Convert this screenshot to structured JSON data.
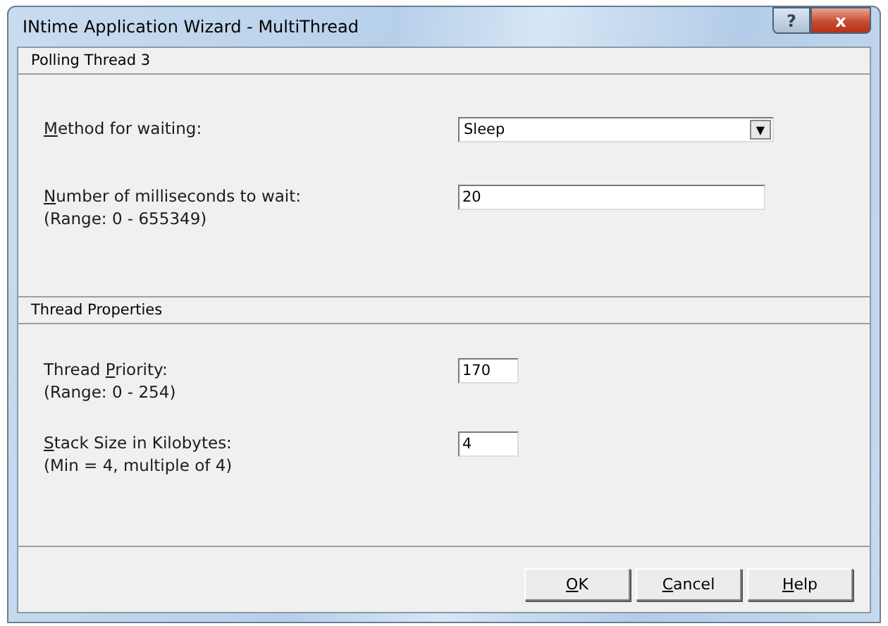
{
  "window": {
    "title": "INtime Application Wizard - MultiThread",
    "caption_buttons": [
      {
        "kind": "help",
        "label": "?"
      },
      {
        "kind": "close",
        "label": "x"
      }
    ]
  },
  "sections": [
    {
      "title": "Polling Thread 3",
      "fields": [
        {
          "kind": "dropdown",
          "label": {
            "key": "M",
            "after": "ethod for waiting:"
          },
          "value": "Sleep",
          "arrow": "▼"
        },
        {
          "kind": "wide_text",
          "label": {
            "key": "N",
            "after": "umber of milliseconds to wait:"
          },
          "hint": "(Range:  0 - 655349)",
          "value": "20"
        }
      ]
    },
    {
      "title": "Thread Properties",
      "fields": [
        {
          "kind": "narrow_text",
          "label": {
            "before": "Thread ",
            "key": "P",
            "after": "riority:"
          },
          "hint": "(Range:  0 - 254)",
          "value": "170"
        },
        {
          "kind": "narrow_text",
          "label": {
            "key": "S",
            "after": "tack Size in Kilobytes:"
          },
          "hint": "(Min = 4, multiple of 4)",
          "value": "4"
        }
      ]
    }
  ],
  "buttons": [
    {
      "key": "O",
      "after": "K"
    },
    {
      "key": "C",
      "after": "ancel"
    },
    {
      "key": "H",
      "after": "elp"
    }
  ]
}
